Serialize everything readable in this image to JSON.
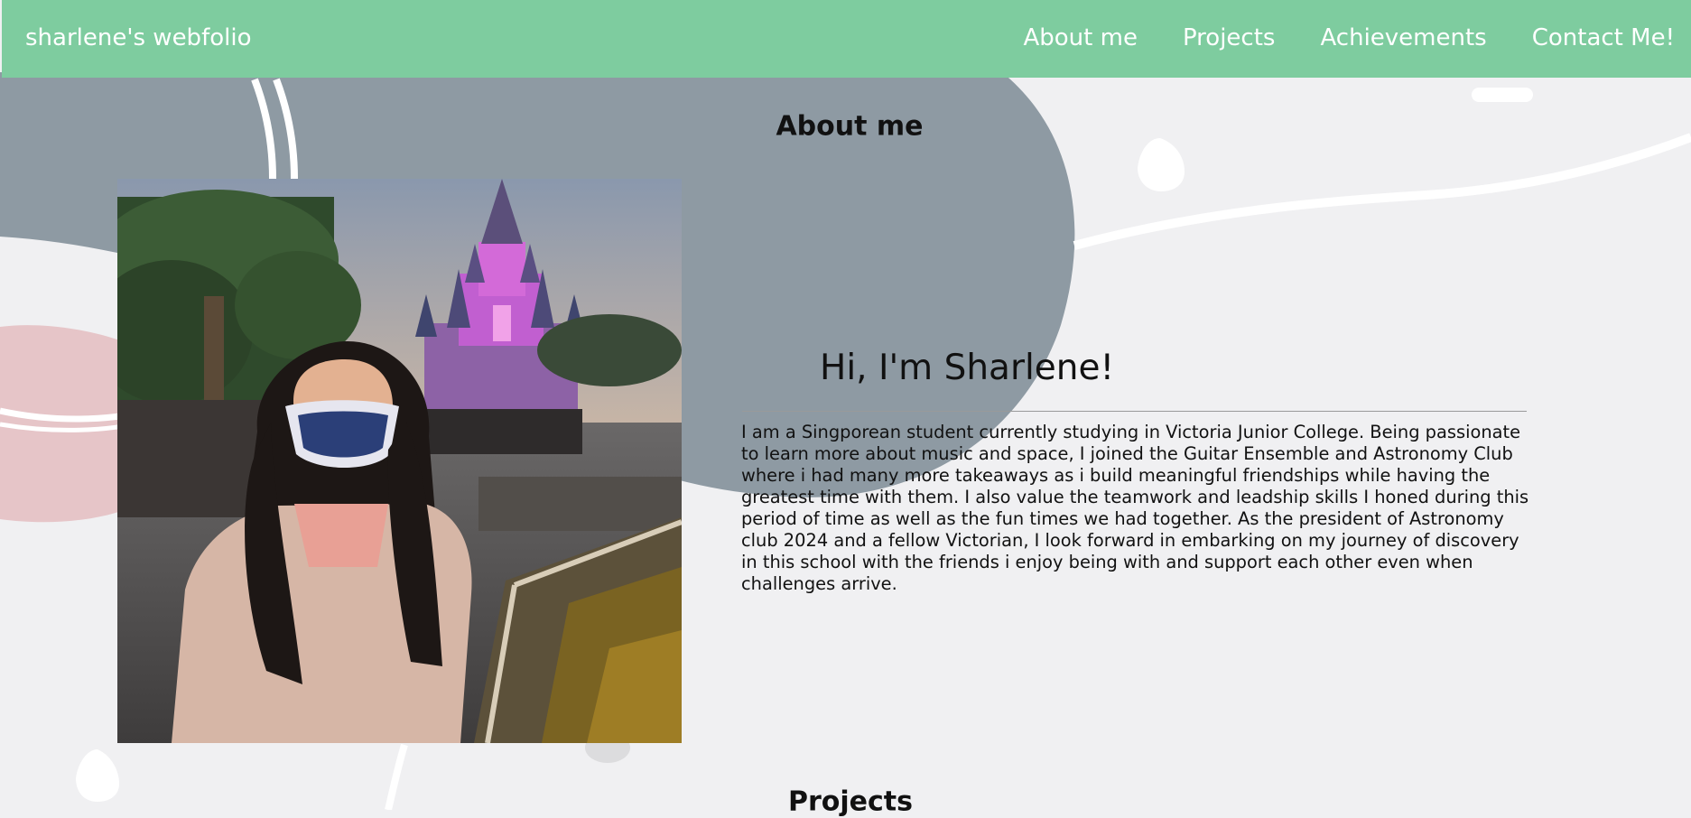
{
  "nav": {
    "brand": "sharlene's webfolio",
    "links": [
      "About me",
      "Projects",
      "Achievements",
      "Contact Me!"
    ]
  },
  "about": {
    "heading": "About me",
    "greeting": "Hi, I'm Sharlene!",
    "bio": "I am a Singporean student currently studying in Victoria Junior College. Being passionate to learn more about music and space, I joined the Guitar Ensemble and Astronomy Club where i had many more takeaways as i build meaningful friendships while having the greatest time with them. I also value the teamwork and leadship skills I honed during this period of time as well as the fun times we had together. As the president of Astronomy club 2024 and a fellow Victorian, I look forward in embarking on my journey of discovery in this school with the friends i enjoy being with and support each other even when challenges arrive."
  },
  "projects": {
    "heading": "Projects"
  },
  "colors": {
    "navbar": "#7ecc9f",
    "page_background": "#f0f0f2",
    "blob_gray": "#8e9aa3",
    "blob_pink": "#e6c5c8"
  }
}
